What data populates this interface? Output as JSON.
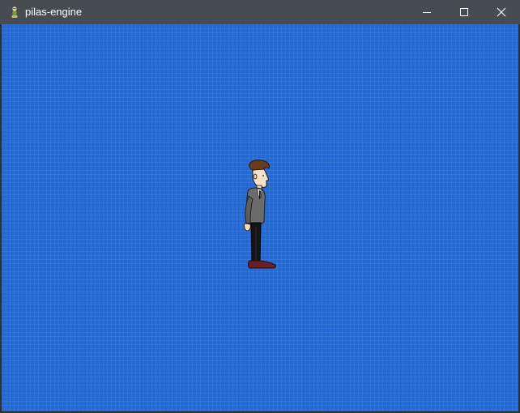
{
  "window": {
    "title": "pilas-engine",
    "app_icon": "pilas-logo-icon",
    "controls": {
      "minimize_icon": "minimize-icon",
      "maximize_icon": "maximize-icon",
      "close_icon": "close-icon"
    }
  },
  "canvas": {
    "background_color": "#2469d2",
    "actor": {
      "icon": "man-in-suit-sprite"
    }
  },
  "colors": {
    "titlebar": "#474c52",
    "titlebar_text": "#ffffff",
    "canvas_blue": "#2469d2"
  }
}
